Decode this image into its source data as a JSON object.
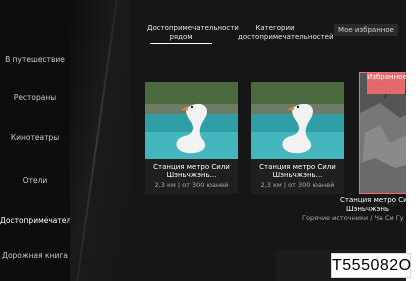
{
  "sidebar": {
    "items": [
      {
        "label": "В путешествие"
      },
      {
        "label": "Рестораны"
      },
      {
        "label": "Кинотеатры"
      },
      {
        "label": "Отели"
      },
      {
        "label": "Достопримечательности"
      },
      {
        "label": "Дорожная книга"
      }
    ]
  },
  "tabs": [
    {
      "label": "Достопримечательности рядом",
      "active": true
    },
    {
      "label": "Категории достопримечательностей"
    },
    {
      "label": "Мое избранное"
    }
  ],
  "cards": [
    {
      "title_line1": "Станция метро Сили",
      "title_line2": "Шэньчжэнь...",
      "meta": "2,3 км | от 300 юаней"
    },
    {
      "title_line1": "Станция метро Сили",
      "title_line2": "Шэньчжэнь...",
      "meta": "2,3 км | от 300 юаней"
    },
    {
      "badge": "Избранное",
      "title_line1": "Станция метро Сили",
      "title_line2": "Шэньчжэнь",
      "meta": "Горячие источники / Ча Си Гу"
    }
  ],
  "watermark_id": "T555082O",
  "colors": {
    "accent": "#e36a6a",
    "background": "#161616"
  }
}
